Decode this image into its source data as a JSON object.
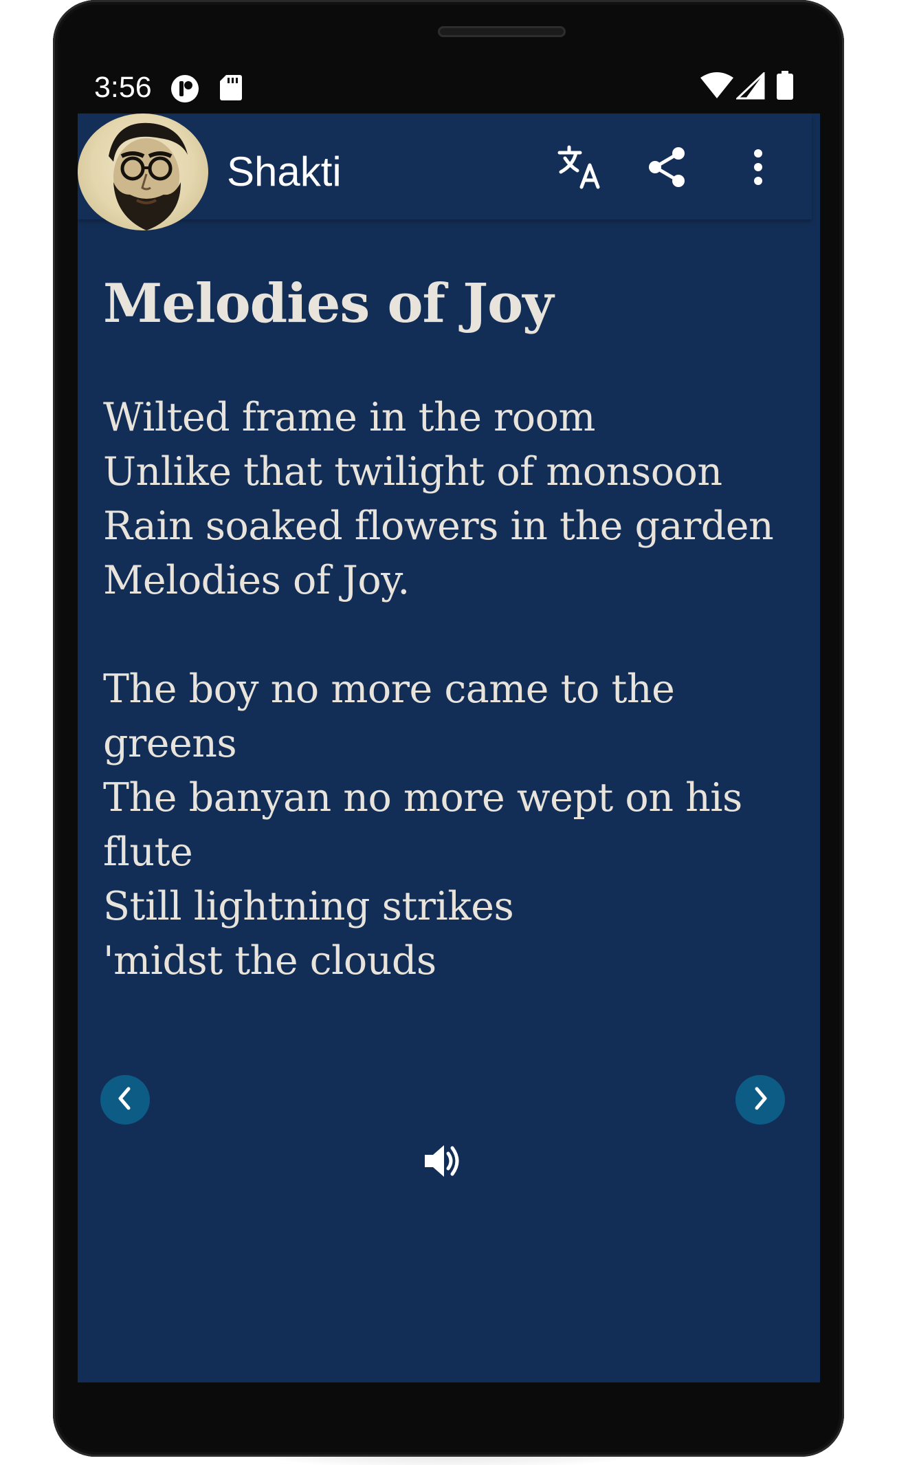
{
  "status_bar": {
    "time": "3:56"
  },
  "app_bar": {
    "title": "Shakti",
    "actions": [
      "translate-icon",
      "share-icon",
      "more-vert-icon"
    ]
  },
  "poem": {
    "title": "Melodies of Joy",
    "stanza1": [
      "Wilted frame in the room",
      "Unlike that twilight of monsoon",
      "Rain soaked flowers in the garden",
      "Melodies of Joy."
    ],
    "stanza2": [
      "The boy no more came to the",
      "greens",
      "The banyan no more wept on his",
      "flute",
      "Still lightning strikes",
      "'midst the clouds"
    ]
  },
  "navigation": {
    "prev_icon": "chevron-left-icon",
    "next_icon": "chevron-right-icon",
    "audio_icon": "volume-up-icon"
  },
  "colors": {
    "background": "#132e56",
    "app_bar": "#142f57",
    "text": "#e8e4dc",
    "nav_button": "#0d5c86"
  }
}
